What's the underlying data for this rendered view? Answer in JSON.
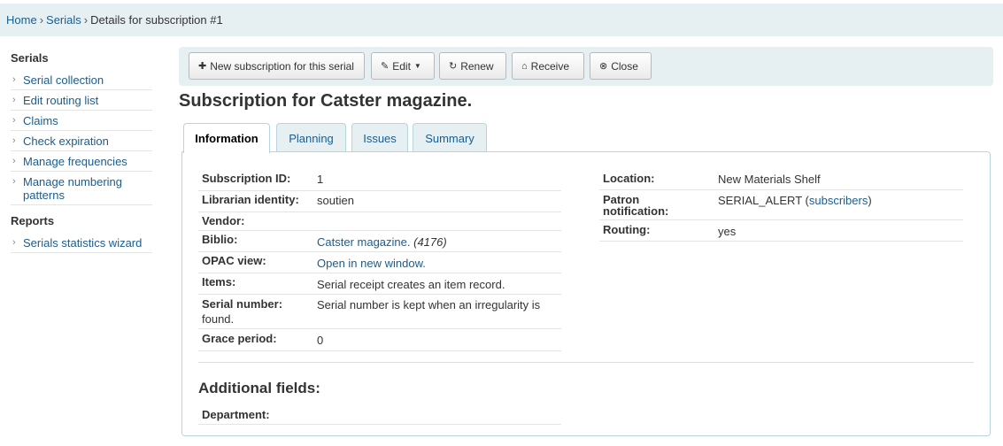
{
  "breadcrumb": {
    "home": "Home",
    "serials": "Serials",
    "current": "Details for subscription #1",
    "separator": "›"
  },
  "sidebar": {
    "serials_heading": "Serials",
    "serials_items": [
      {
        "label": "Serial collection"
      },
      {
        "label": "Edit routing list"
      },
      {
        "label": "Claims"
      },
      {
        "label": "Check expiration"
      },
      {
        "label": "Manage frequencies"
      },
      {
        "label": "Manage numbering patterns"
      }
    ],
    "reports_heading": "Reports",
    "reports_items": [
      {
        "label": "Serials statistics wizard"
      }
    ],
    "bullet": "›"
  },
  "toolbar": {
    "new_subscription": "New subscription for this serial",
    "edit": "Edit",
    "renew": "Renew",
    "receive": "Receive",
    "close": "Close"
  },
  "page_title": "Subscription for Catster magazine.",
  "tabs": [
    {
      "label": "Information",
      "active": true
    },
    {
      "label": "Planning"
    },
    {
      "label": "Issues"
    },
    {
      "label": "Summary"
    }
  ],
  "left_fields": {
    "subscription_id": {
      "label": "Subscription ID:",
      "value": "1"
    },
    "librarian": {
      "label": "Librarian identity:",
      "value": "soutien"
    },
    "vendor": {
      "label": "Vendor:",
      "value": ""
    },
    "biblio": {
      "label": "Biblio:",
      "link": "Catster magazine.",
      "extra": "(4176)"
    },
    "opac": {
      "label": "OPAC view:",
      "link": "Open in new window."
    },
    "items": {
      "label": "Items:",
      "value": "Serial receipt creates an item record."
    },
    "serial_number": {
      "label_line1": "Serial number:",
      "label_line2": "found.",
      "value": "Serial number is kept when an irregularity is"
    },
    "grace": {
      "label": "Grace period:",
      "value": "0"
    }
  },
  "right_fields": {
    "location": {
      "label": "Location:",
      "value": "New Materials Shelf"
    },
    "patron": {
      "label_line1": "Patron",
      "label_line2": "notification:",
      "value": "SERIAL_ALERT",
      "open": " (",
      "link": "subscribers",
      "close": ")"
    },
    "routing": {
      "label": "Routing:",
      "value": "yes"
    }
  },
  "additional": {
    "heading": "Additional fields:",
    "department": {
      "label": "Department:",
      "value": ""
    }
  },
  "colors": {
    "link": "#1a5d8f",
    "bar_bg": "#e6f0f2",
    "tab_border": "#b7d5dd"
  }
}
